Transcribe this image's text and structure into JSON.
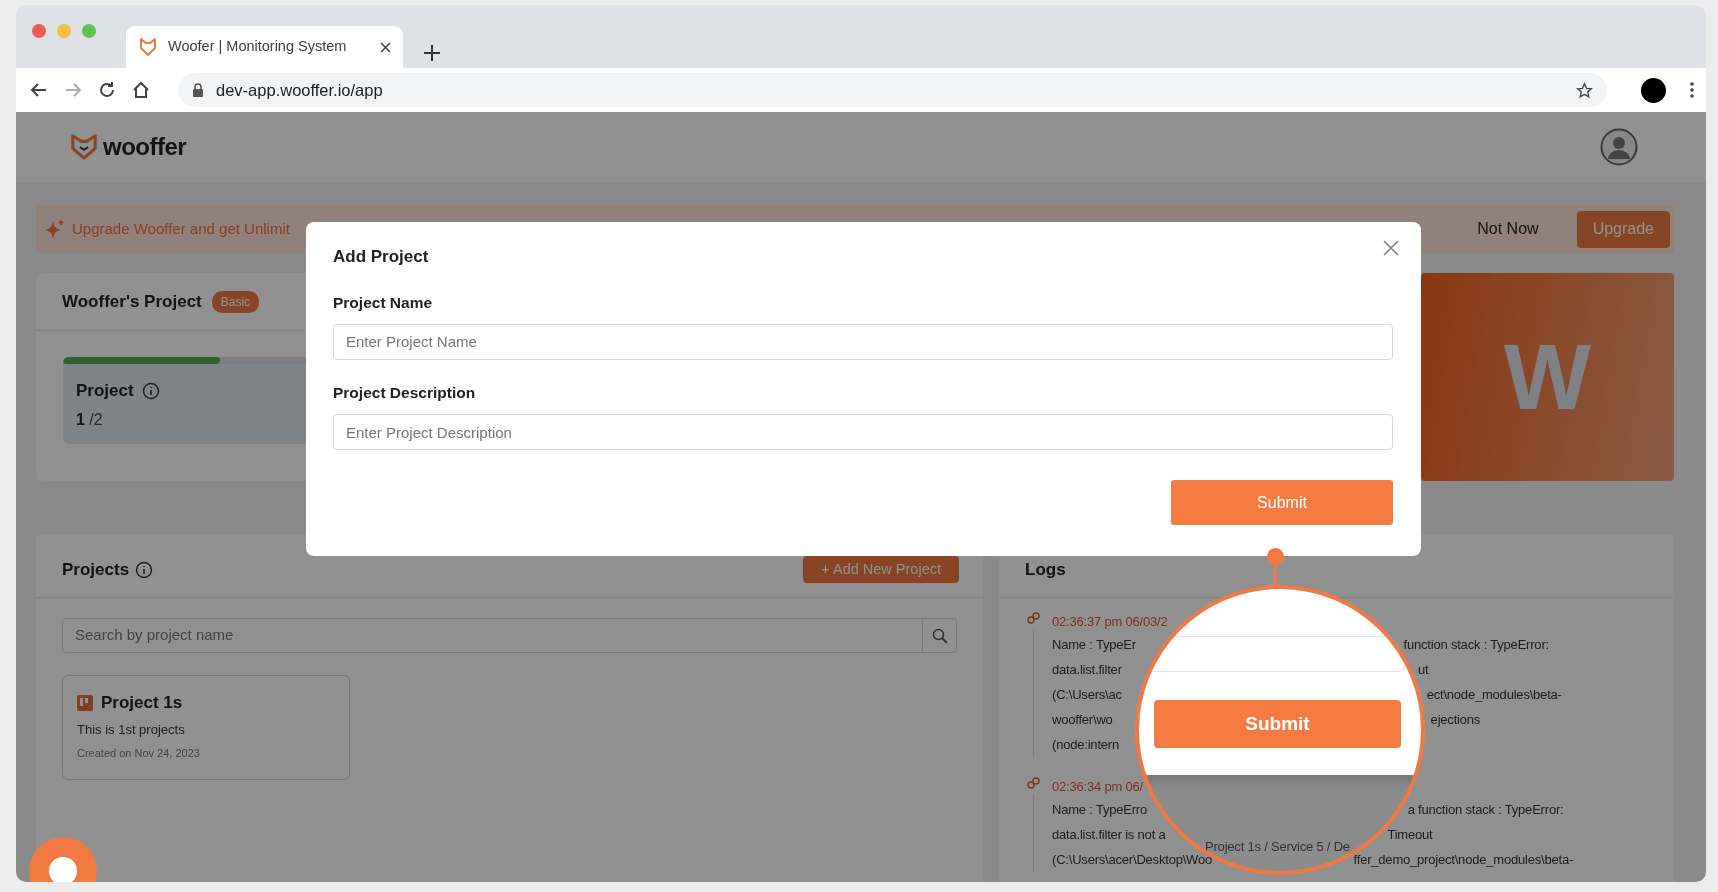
{
  "browser": {
    "tab_title": "Woofer | Monitoring System",
    "url": "dev-app.wooffer.io/app"
  },
  "header": {
    "logo_text": "wooffer"
  },
  "banner": {
    "text": "Upgrade Wooffer and get Unlimit",
    "dismiss": "Not Now",
    "action": "Upgrade"
  },
  "workspace": {
    "title": "Wooffer's Project",
    "plan": "Basic",
    "stat": {
      "label": "Project",
      "value": "1",
      "total": "/2",
      "level": 0.5
    },
    "initial": "W"
  },
  "projects": {
    "title": "Projects",
    "add_button": "+ Add New Project",
    "search_placeholder": "Search by project name",
    "items": [
      {
        "name": "Project 1s",
        "description": "This is 1st projects",
        "created": "Created on Nov 24, 2023"
      }
    ]
  },
  "logs": {
    "title": "Logs",
    "entries": [
      {
        "time": "02:36:37 pm 06/03/2",
        "lines": [
          {
            "left": "Name : TypeEr",
            "right": "function stack : TypeError:"
          },
          {
            "left": "data.list.filter",
            "right": "ut"
          },
          {
            "left": "(C:\\Users\\ac",
            "right": "ect\\node_modules\\beta-"
          },
          {
            "left": "wooffer\\wo",
            "right": "ejections"
          },
          {
            "left": "(node:intern"
          }
        ]
      },
      {
        "time": "02:36:34 pm 06/",
        "lines": [
          {
            "left": "Name : TypeErro",
            "right": "a function stack : TypeError:"
          },
          {
            "left": "data.list.filter is not a",
            "right": "Timeout"
          },
          {
            "left": "(C:\\Users\\acer\\Desktop\\Woo",
            "right": "ffer_demo_project\\node_modules\\beta-"
          }
        ]
      }
    ]
  },
  "modal": {
    "title": "Add Project",
    "fields": [
      {
        "label": "Project Name",
        "placeholder": "Enter Project Name"
      },
      {
        "label": "Project Description",
        "placeholder": "Enter Project Description"
      }
    ],
    "submit": "Submit"
  },
  "magnifier": {
    "button": "Submit",
    "background_text": "Project 1s / Service 5 / De"
  }
}
